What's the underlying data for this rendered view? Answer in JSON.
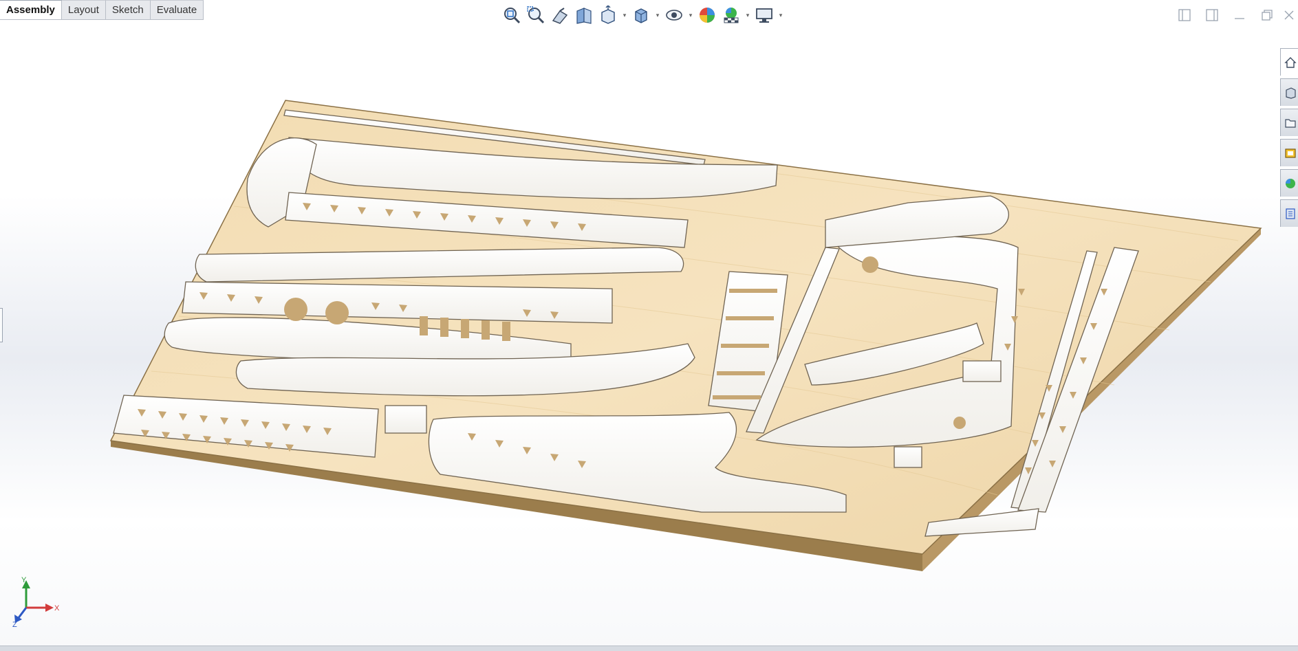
{
  "command_tabs": [
    {
      "label": "Assembly",
      "active": true
    },
    {
      "label": "Layout",
      "active": false
    },
    {
      "label": "Sketch",
      "active": false
    },
    {
      "label": "Evaluate",
      "active": false
    }
  ],
  "heads_up_toolbar": [
    "zoom-to-fit-icon",
    "zoom-to-area-icon",
    "previous-view-icon",
    "section-view-icon",
    "view-orientation-icon",
    "display-style-icon",
    "hide-show-items-icon",
    "edit-appearance-icon",
    "apply-scene-icon",
    "view-settings-icon"
  ],
  "window_controls": [
    "tile-left-icon",
    "tile-right-icon",
    "minimize-icon",
    "restore-icon",
    "close-icon"
  ],
  "task_pane": [
    "home-icon",
    "design-library-icon",
    "file-explorer-icon",
    "view-palette-icon",
    "appearances-icon",
    "custom-properties-icon"
  ],
  "triad": {
    "x": "X",
    "y": "Y",
    "z": "Z"
  },
  "colors": {
    "plywood": "#efd9b0",
    "plywood_edge": "#8a7045",
    "part_face": "#fbfaf7",
    "part_side": "#b8a78a",
    "accent_green": "#2e9b3a",
    "accent_red": "#d23c3c",
    "accent_blue": "#2d59c4"
  }
}
